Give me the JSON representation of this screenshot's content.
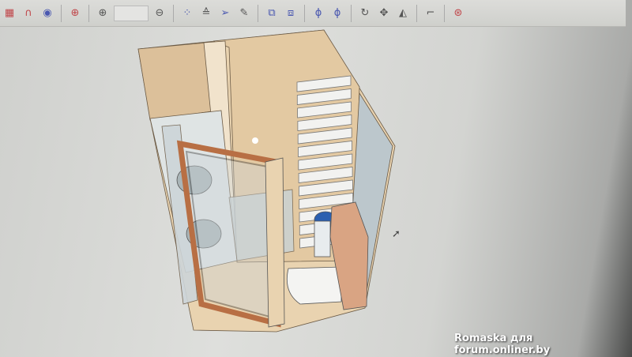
{
  "toolbar": {
    "icons": [
      "grid-icon",
      "magnet-icon",
      "snap-icon",
      "target-icon",
      "zoom-in-icon",
      "zoom-select",
      "zoom-out-icon",
      "select-all-icon",
      "elevate-icon",
      "select-arrow-icon",
      "pencil-icon",
      "group-icon",
      "ungroup-icon",
      "rotate-x-icon",
      "rotate-y-icon",
      "rotate-icon",
      "move-icon",
      "mirror-icon",
      "profile-icon",
      "help-icon"
    ],
    "zoom_value": ""
  },
  "colors": {
    "wall": "#e6cda8",
    "tile": "#f2f2f0",
    "door_frame": "#b86f44",
    "glass": "#bcc7cc",
    "bowl": "#2a5fb0"
  },
  "watermark": "Romaska для forum.onliner.by"
}
